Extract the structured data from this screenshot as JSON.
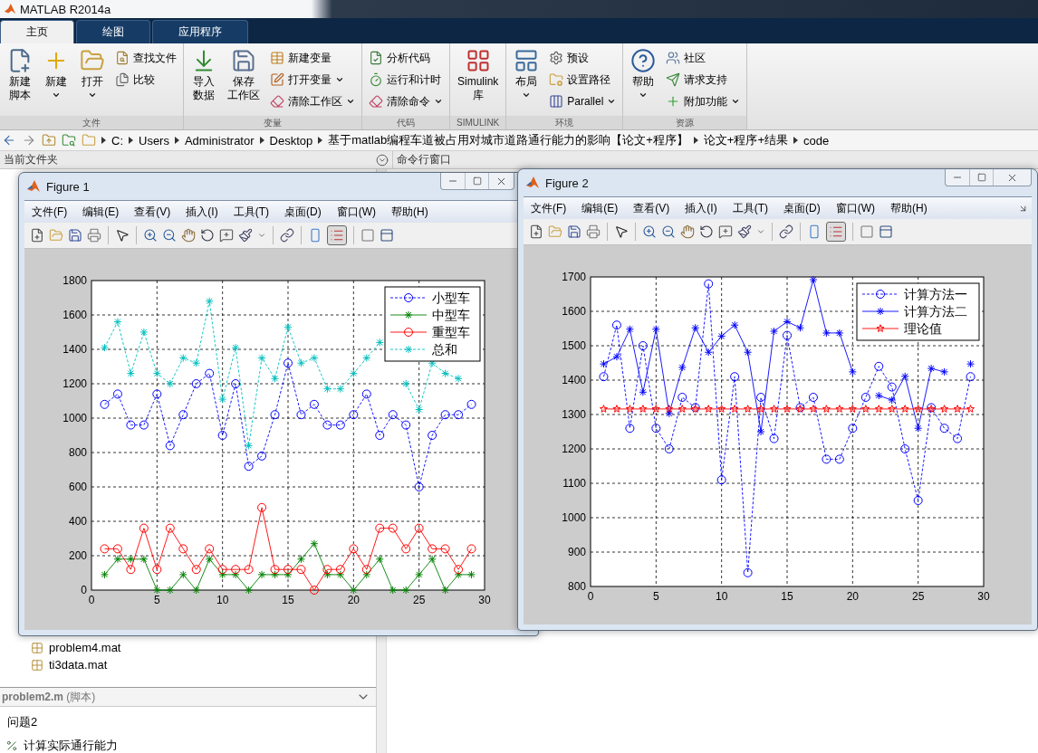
{
  "window": {
    "title": "MATLAB R2014a"
  },
  "tabs": [
    {
      "label": "主页",
      "selected": true
    },
    {
      "label": "绘图",
      "selected": false
    },
    {
      "label": "应用程序",
      "selected": false
    }
  ],
  "toolstrip": {
    "groups": [
      {
        "label": "文件",
        "items": [
          {
            "kind": "large",
            "label": "新建脚本",
            "dropdown": false
          },
          {
            "kind": "large",
            "label": "新建",
            "dropdown": true
          },
          {
            "kind": "large",
            "label": "打开",
            "dropdown": true
          },
          {
            "kind": "stack",
            "items": [
              {
                "label": "查找文件",
                "dropdown": false
              },
              {
                "label": "比较",
                "dropdown": false
              }
            ]
          }
        ]
      },
      {
        "label": "变量",
        "items": [
          {
            "kind": "large",
            "label": "导入数据",
            "dropdown": false
          },
          {
            "kind": "large",
            "label": "保存工作区",
            "dropdown": false
          },
          {
            "kind": "stack",
            "items": [
              {
                "label": "新建变量",
                "dropdown": false
              },
              {
                "label": "打开变量",
                "dropdown": true
              },
              {
                "label": "清除工作区",
                "dropdown": true
              }
            ]
          }
        ]
      },
      {
        "label": "代码",
        "items": [
          {
            "kind": "stack",
            "items": [
              {
                "label": "分析代码",
                "dropdown": false
              },
              {
                "label": "运行和计时",
                "dropdown": false
              },
              {
                "label": "清除命令",
                "dropdown": true
              }
            ]
          }
        ]
      },
      {
        "label": "SIMULINK",
        "items": [
          {
            "kind": "large",
            "label": "Simulink库",
            "dropdown": false
          }
        ]
      },
      {
        "label": "环境",
        "items": [
          {
            "kind": "large",
            "label": "布局",
            "dropdown": true
          },
          {
            "kind": "stack",
            "items": [
              {
                "label": "预设",
                "dropdown": false
              },
              {
                "label": "设置路径",
                "dropdown": false
              },
              {
                "label": "Parallel",
                "dropdown": true
              }
            ]
          }
        ]
      },
      {
        "label": "资源",
        "items": [
          {
            "kind": "large",
            "label": "帮助",
            "dropdown": true
          },
          {
            "kind": "stack",
            "items": [
              {
                "label": "社区",
                "dropdown": false
              },
              {
                "label": "请求支持",
                "dropdown": false
              },
              {
                "label": "附加功能",
                "dropdown": true
              }
            ]
          }
        ]
      }
    ]
  },
  "address_bar": {
    "segments": [
      "C:",
      "Users",
      "Administrator",
      "Desktop",
      "基于matlab编程车道被占用对城市道路通行能力的影响【论文+程序】",
      "论文+程序+结果",
      "code"
    ]
  },
  "current_folder": {
    "title": "当前文件夹",
    "files": [
      "problem4.mat",
      "ti3data.mat"
    ]
  },
  "details": {
    "header": "**problem2.m** (脚本)",
    "lines": [
      {
        "kind": "text",
        "text": "问题2"
      },
      {
        "kind": "section",
        "text": "计算实际通行能力"
      }
    ]
  },
  "command_window": {
    "title": "命令行窗口"
  },
  "figures": [
    {
      "title": "Figure 1",
      "menu": [
        "文件(F)",
        "编辑(E)",
        "查看(V)",
        "插入(I)",
        "工具(T)",
        "桌面(D)",
        "窗口(W)",
        "帮助(H)"
      ],
      "legend_selected": true,
      "chart_data": {
        "type": "line",
        "grid": true,
        "legend": true,
        "x": [
          1,
          2,
          3,
          4,
          5,
          6,
          7,
          8,
          9,
          10,
          11,
          12,
          13,
          14,
          15,
          16,
          17,
          18,
          19,
          20,
          21,
          22,
          23,
          24,
          25,
          26,
          27,
          28,
          29
        ],
        "xlim": [
          0,
          30
        ],
        "ylim": [
          0,
          1800
        ],
        "xticks": [
          0,
          5,
          10,
          15,
          20,
          25,
          30
        ],
        "yticks": [
          0,
          200,
          400,
          600,
          800,
          1000,
          1200,
          1400,
          1600,
          1800
        ],
        "series": [
          {
            "name": "小型车",
            "color": "#0000ff",
            "marker": "circle",
            "line_style": "dashed",
            "values": [
              1080,
              1140,
              960,
              960,
              1140,
              840,
              1020,
              1200,
              1260,
              900,
              1200,
              720,
              780,
              1020,
              1320,
              1020,
              1080,
              960,
              960,
              1020,
              1140,
              900,
              1020,
              960,
              600,
              900,
              1020,
              1020,
              1080
            ]
          },
          {
            "name": "中型车",
            "color": "#008000",
            "marker": "cross",
            "line_style": "solid",
            "values": [
              90,
              180,
              180,
              180,
              0,
              0,
              90,
              0,
              180,
              90,
              90,
              0,
              90,
              90,
              90,
              180,
              270,
              90,
              90,
              0,
              90,
              180,
              0,
              0,
              90,
              180,
              0,
              90,
              90
            ]
          },
          {
            "name": "重型车",
            "color": "#ff0000",
            "marker": "circle",
            "line_style": "solid",
            "values": [
              240,
              240,
              120,
              360,
              120,
              360,
              240,
              120,
              240,
              120,
              120,
              120,
              480,
              120,
              120,
              120,
              0,
              120,
              120,
              240,
              120,
              360,
              360,
              240,
              360,
              240,
              240,
              120,
              240
            ]
          },
          {
            "name": "总和",
            "color": "#00bfbf",
            "marker": "cross",
            "line_style": "dashed",
            "values": [
              1410,
              1560,
              1260,
              1500,
              1260,
              1200,
              1350,
              1320,
              1680,
              1110,
              1410,
              840,
              1350,
              1230,
              1530,
              1320,
              1350,
              1170,
              1170,
              1260,
              1350,
              1440,
              null,
              1200,
              1050,
              1320,
              1260,
              1230,
              null
            ]
          }
        ]
      }
    },
    {
      "title": "Figure 2",
      "menu": [
        "文件(F)",
        "编辑(E)",
        "查看(V)",
        "插入(I)",
        "工具(T)",
        "桌面(D)",
        "窗口(W)",
        "帮助(H)"
      ],
      "legend_selected": true,
      "chart_data": {
        "type": "line",
        "grid": true,
        "legend": true,
        "x": [
          1,
          2,
          3,
          4,
          5,
          6,
          7,
          8,
          9,
          10,
          11,
          12,
          13,
          14,
          15,
          16,
          17,
          18,
          19,
          20,
          21,
          22,
          23,
          24,
          25,
          26,
          27,
          28,
          29
        ],
        "xlim": [
          0,
          30
        ],
        "ylim": [
          800,
          1700
        ],
        "xticks": [
          0,
          5,
          10,
          15,
          20,
          25,
          30
        ],
        "yticks": [
          800,
          900,
          1000,
          1100,
          1200,
          1300,
          1400,
          1500,
          1600,
          1700
        ],
        "series": [
          {
            "name": "计算方法一",
            "color": "#0000ff",
            "marker": "circle",
            "line_style": "dashed",
            "values": [
              1410,
              1560,
              1260,
              1500,
              1260,
              1200,
              1350,
              1320,
              1680,
              1110,
              1410,
              840,
              1350,
              1230,
              1530,
              1320,
              1350,
              1170,
              1170,
              1260,
              1350,
              1440,
              1380,
              1200,
              1050,
              1320,
              1260,
              1230,
              1410
            ]
          },
          {
            "name": "计算方法二",
            "color": "#0000ff",
            "marker": "cross",
            "line_style": "solid",
            "values": [
              1447,
              1468,
              1548,
              1365,
              1548,
              1303,
              1437,
              1552,
              1481,
              1528,
              1560,
              1481,
              1250,
              1542,
              1570,
              1552,
              1692,
              1537,
              1537,
              1424,
              null,
              1355,
              1342,
              1411,
              1260,
              1434,
              1424,
              null,
              1447
            ]
          },
          {
            "name": "理论值",
            "color": "#ff0000",
            "marker": "star",
            "line_style": "solid",
            "values": [
              1316,
              1316,
              1316,
              1316,
              1316,
              1316,
              1316,
              1316,
              1316,
              1316,
              1316,
              1316,
              1316,
              1316,
              1316,
              1316,
              1316,
              1316,
              1316,
              1316,
              1316,
              1316,
              1316,
              1316,
              1316,
              1316,
              1316,
              1316,
              1316
            ]
          }
        ]
      }
    }
  ]
}
